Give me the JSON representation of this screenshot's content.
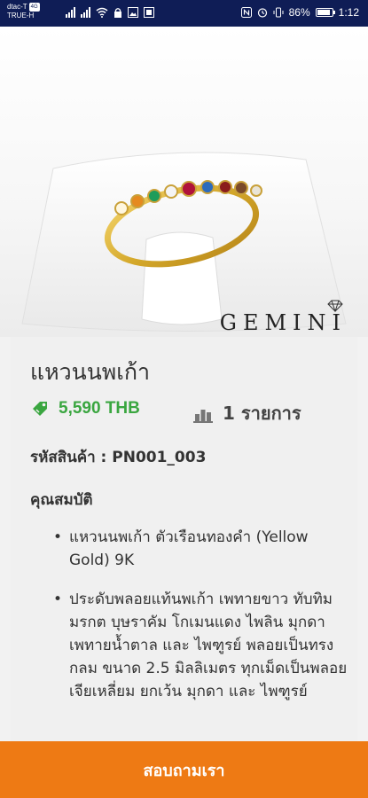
{
  "status_bar": {
    "carrier_primary": "dtac-T",
    "carrier_tag": "4G",
    "carrier_secondary": "TRUE-H",
    "battery_level": "86%",
    "time": "1:12",
    "battery_fraction": 0.86
  },
  "product": {
    "image_brand": "GEMINI",
    "title": "แหวนนพเก้า",
    "price": "5,590 THB",
    "quantity": "1 รายการ",
    "sku": "รหัสสินค้า : PN001_003",
    "properties_title": "คุณสมบัติ",
    "properties": [
      "แหวนนพเก้า ตัวเรือนทองคำ (Yellow Gold) 9K",
      "ประดับพลอยแท้นพเก้า เพทายขาว ทับทิม มรกต บุษราคัม โกเมนแดง ไพลิน มุกดา เพทายน้ำตาล และ ไพฑูรย์ พลอยเป็นทรงกลม ขนาด 2.5 มิลลิเมตร ทุกเม็ดเป็นพลอยเจียเหลี่ยม ยกเว้น มุกดา และ ไพฑูรย์"
    ]
  },
  "cta": {
    "label": "สอบถามเรา"
  },
  "colors": {
    "status_bar_bg": "#0f1d56",
    "price_green": "#3aa640",
    "cta_orange": "#ee7a14",
    "gold": "#d4a82a"
  }
}
